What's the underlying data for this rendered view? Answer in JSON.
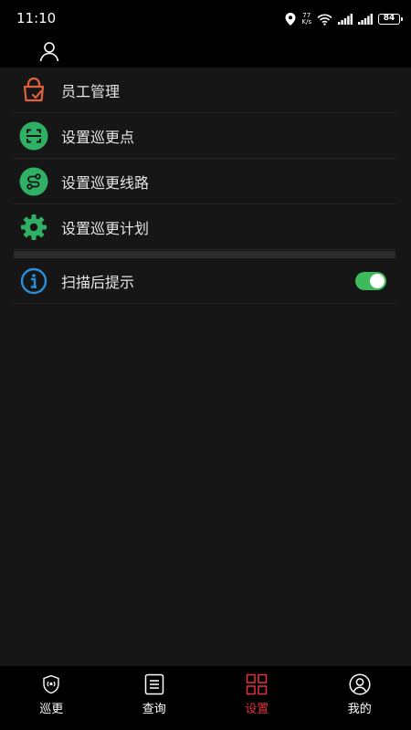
{
  "status_bar": {
    "time": "11:10",
    "net_speed_value": "77",
    "net_speed_unit": "K/s",
    "battery": "84"
  },
  "settings": {
    "items": [
      {
        "label": "员工管理",
        "icon": "staff-bag-icon",
        "icon_color": "#e2603a"
      },
      {
        "label": "设置巡更点",
        "icon": "scan-point-icon",
        "icon_color": "#2fb064"
      },
      {
        "label": "设置巡更线路",
        "icon": "route-icon",
        "icon_color": "#2fb064"
      },
      {
        "label": "设置巡更计划",
        "icon": "gear-icon",
        "icon_color": "#2fb064"
      }
    ],
    "scan_prompt": {
      "label": "扫描后提示",
      "icon": "info-icon",
      "icon_color": "#2a8fdc",
      "enabled": true
    }
  },
  "tab_bar": {
    "tabs": [
      {
        "label": "巡更",
        "icon": "patrol-shield-icon",
        "active": false
      },
      {
        "label": "查询",
        "icon": "list-doc-icon",
        "active": false
      },
      {
        "label": "设置",
        "icon": "grid-icon",
        "active": true
      },
      {
        "label": "我的",
        "icon": "user-circle-icon",
        "active": false
      }
    ],
    "active_color": "#e0333d"
  }
}
